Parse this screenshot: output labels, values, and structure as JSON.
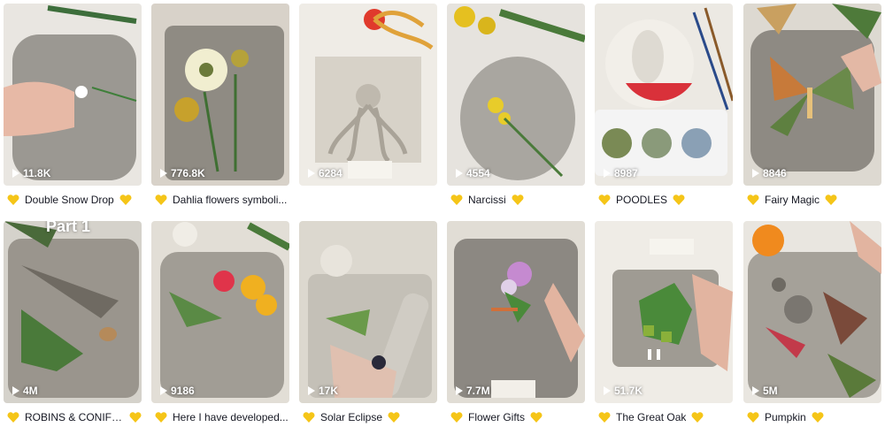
{
  "videos": [
    {
      "caption": "Double Snow Drop",
      "views": "11.8K",
      "tone": "#b8b4ac"
    },
    {
      "caption": "Dahlia flowers symboli...",
      "views": "776.8K",
      "tone": "#8f8b83"
    },
    {
      "caption": "",
      "views": "6284",
      "tone": "#d9d5cc"
    },
    {
      "caption": "Narcissi",
      "views": "4554",
      "tone": "#a9a6a0"
    },
    {
      "caption": "POODLES",
      "views": "8987",
      "tone": "#c7c3bb"
    },
    {
      "caption": "Fairy Magic",
      "views": "8846",
      "tone": "#8e8a83"
    },
    {
      "caption": "ROBINS & CONIFERS",
      "views": "4M",
      "tone": "#9a958d"
    },
    {
      "caption": "Here I have developed...",
      "views": "9186",
      "tone": "#a19d95"
    },
    {
      "caption": "Solar Eclipse",
      "views": "17K",
      "tone": "#c4c0b7"
    },
    {
      "caption": "Flower Gifts",
      "views": "7.7M",
      "tone": "#8c8882"
    },
    {
      "caption": "The Great Oak",
      "views": "51.7K",
      "tone": "#b6b2aa"
    },
    {
      "caption": "Pumpkin",
      "views": "5M",
      "tone": "#a5a199"
    }
  ],
  "overlay": {
    "part_label": "Part 1"
  },
  "colors": {
    "heart": "#f5c518",
    "caption": "#161823"
  }
}
